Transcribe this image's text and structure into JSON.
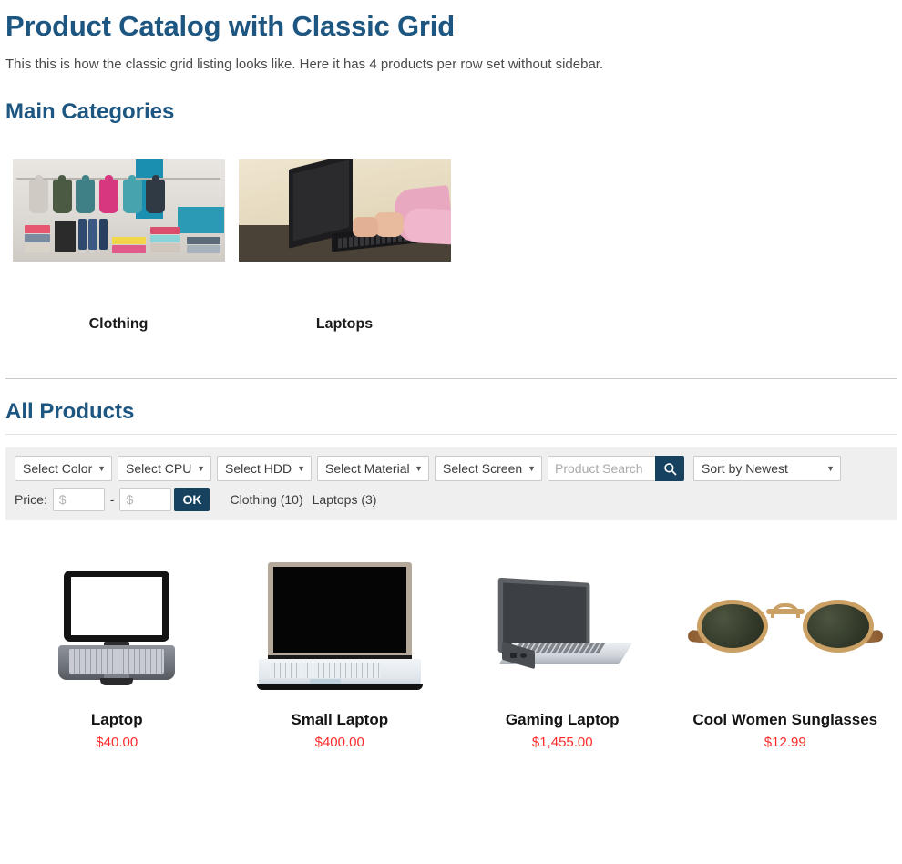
{
  "header": {
    "title": "Product Catalog with Classic Grid",
    "subtitle": "This this is how the classic grid listing looks like. Here it has 4 products per row set without sidebar."
  },
  "categories_section": {
    "title": "Main Categories",
    "items": [
      {
        "label": "Clothing",
        "image": "clothing-store-photo"
      },
      {
        "label": "Laptops",
        "image": "laptop-typing-photo"
      }
    ]
  },
  "products_section": {
    "title": "All Products"
  },
  "filters": {
    "selects": [
      {
        "name": "color",
        "selected": "Select Color"
      },
      {
        "name": "cpu",
        "selected": "Select CPU"
      },
      {
        "name": "hdd",
        "selected": "Select HDD"
      },
      {
        "name": "material",
        "selected": "Select Material"
      },
      {
        "name": "screen",
        "selected": "Select Screen"
      }
    ],
    "search": {
      "value": "",
      "placeholder": "Product Search",
      "button_icon": "search-icon"
    },
    "sort": {
      "selected": "Sort by Newest"
    },
    "price": {
      "label": "Price:",
      "min_value": "",
      "min_placeholder": "$",
      "separator": "-",
      "max_value": "",
      "max_placeholder": "$",
      "ok_label": "OK"
    },
    "category_links": [
      {
        "label": "Clothing (10)"
      },
      {
        "label": "Laptops (3)"
      }
    ]
  },
  "products": [
    {
      "name": "Laptop",
      "price": "$40.00",
      "image": "netbook-white-screen"
    },
    {
      "name": "Small Laptop",
      "price": "$400.00",
      "image": "laptop-front-black-screen"
    },
    {
      "name": "Gaming Laptop",
      "price": "$1,455.00",
      "image": "laptop-angled-silver"
    },
    {
      "name": "Cool Women Sunglasses",
      "price": "$12.99",
      "image": "round-sunglasses-gold"
    }
  ],
  "colors": {
    "heading": "#1c5681",
    "price": "#ff2b2b",
    "accent": "#17425f",
    "filter_bar_bg": "#efefef"
  }
}
